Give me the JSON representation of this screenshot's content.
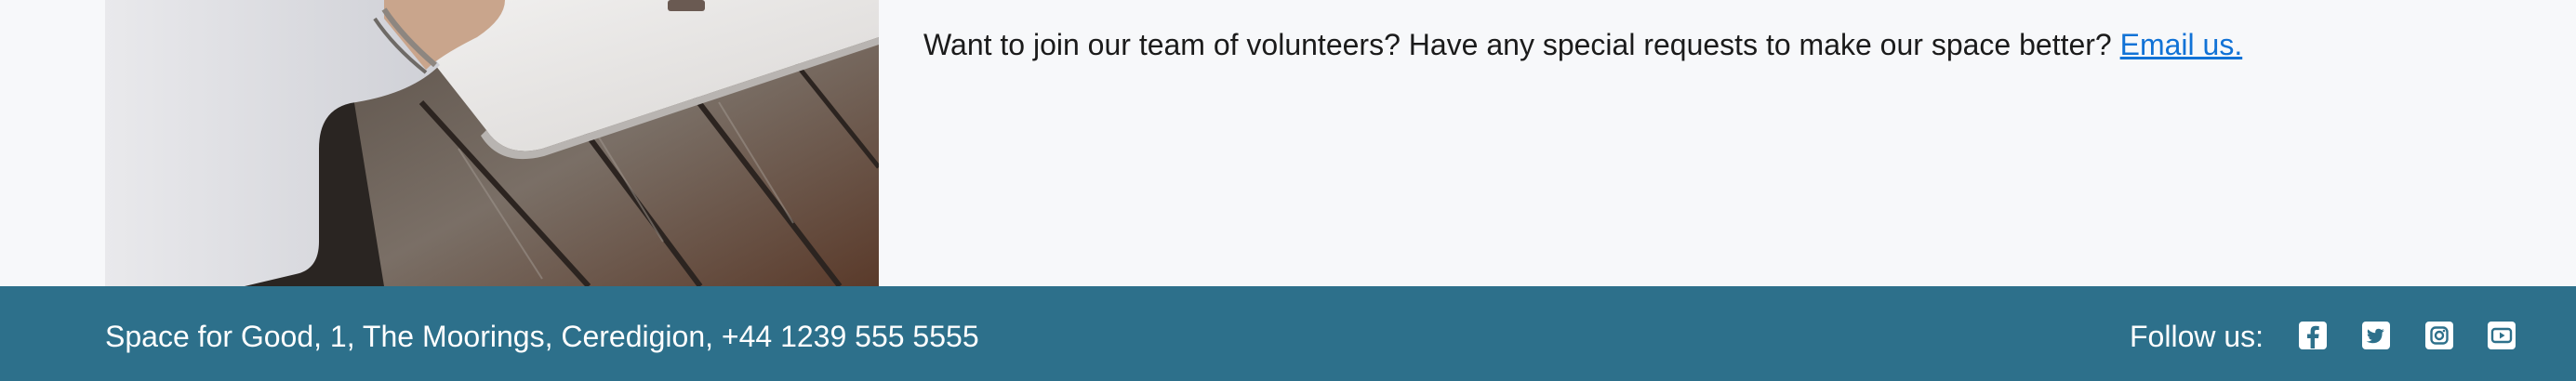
{
  "main": {
    "photo_icon": "laptop-on-wooden-table-photo",
    "text": "Want to join our team of volunteers? Have any special requests to make our space better?",
    "link_text": "Email us."
  },
  "footer": {
    "address": "Space for Good, 1, The Moorings, Ceredigion, +44 1239 555 5555",
    "follow_label": "Follow us:",
    "social_icons": [
      "facebook-icon",
      "twitter-icon",
      "instagram-icon",
      "youtube-icon"
    ]
  },
  "colors": {
    "background": "#f7f8fa",
    "footer": "#2d708b",
    "link": "#1172d6",
    "text": "#1b1b1b"
  }
}
